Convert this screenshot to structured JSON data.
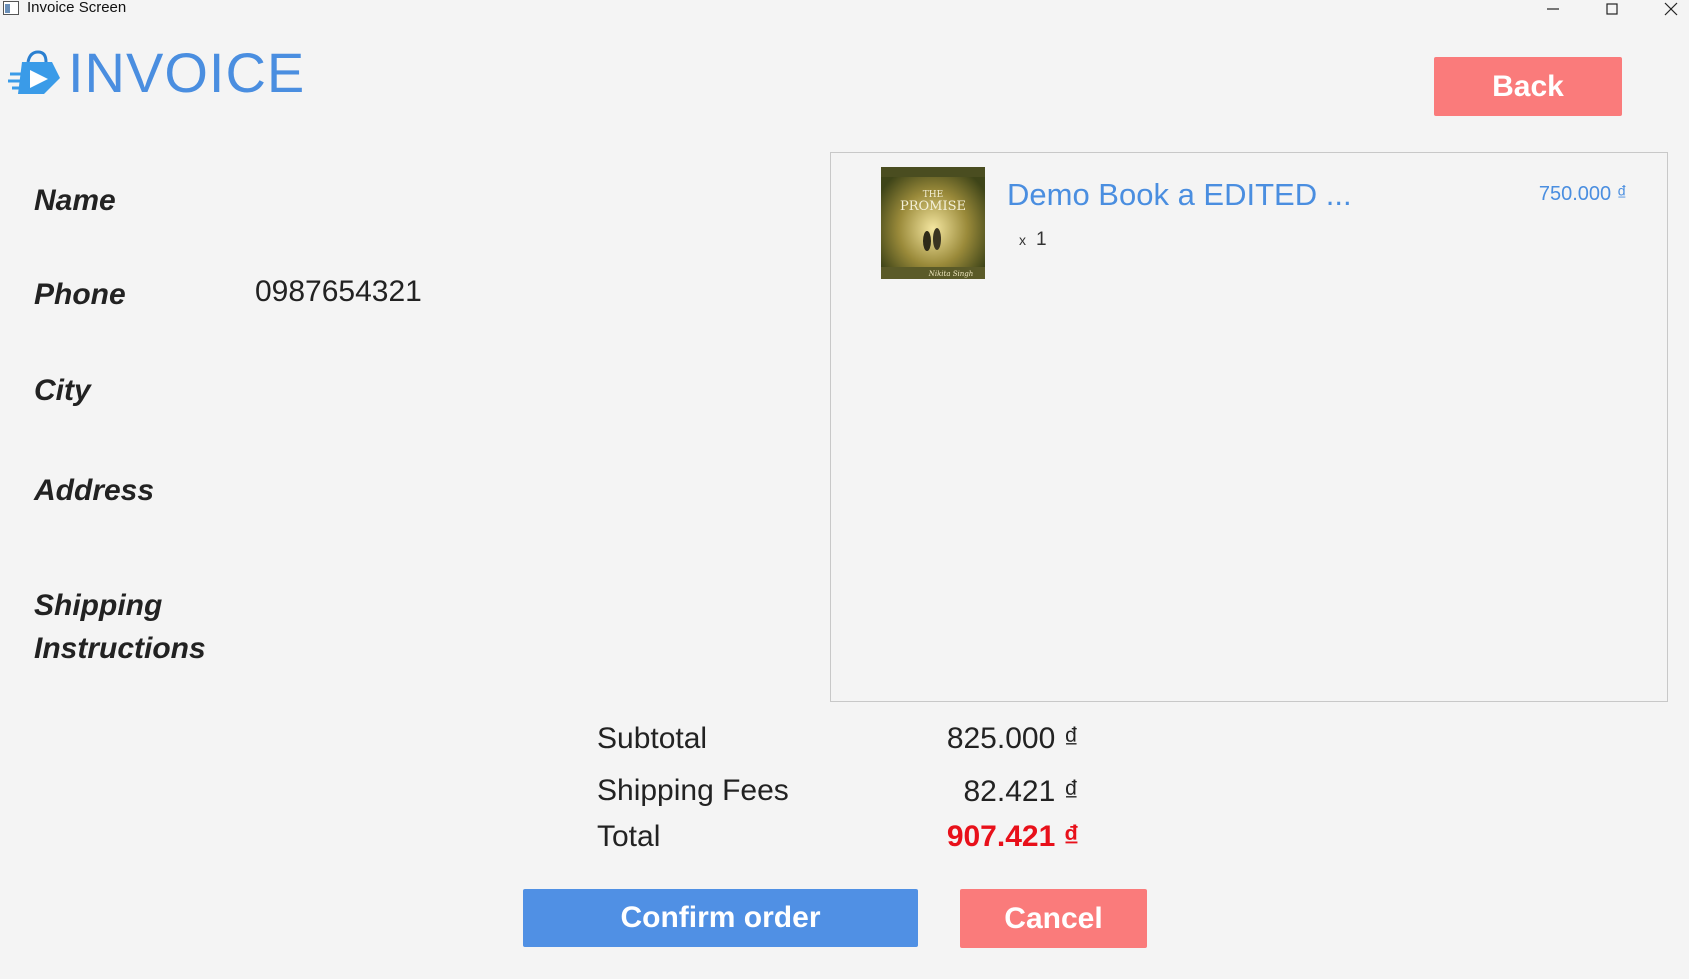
{
  "window": {
    "title": "Invoice Screen"
  },
  "header": {
    "title": "INVOICE",
    "back_label": "Back"
  },
  "form": {
    "name_label": "Name",
    "name_value": "",
    "phone_label": "Phone",
    "phone_value": "0987654321",
    "city_label": "City",
    "city_value": "",
    "address_label": "Address",
    "address_value": "",
    "shipping_label_line1": "Shipping",
    "shipping_label_line2": "Instructions",
    "shipping_value": ""
  },
  "cart": {
    "items": [
      {
        "name": "Demo Book a EDITED ...",
        "qty_prefix": "x",
        "qty": "1",
        "price": "750.000 ₫",
        "cover_icon": "book-cover"
      }
    ]
  },
  "summary": {
    "subtotal_label": "Subtotal",
    "subtotal_value": "825.000 ₫",
    "shipping_label": "Shipping Fees",
    "shipping_value": "82.421 ₫",
    "total_label": "Total",
    "total_value": "907.421 ₫"
  },
  "actions": {
    "confirm_label": "Confirm order",
    "cancel_label": "Cancel"
  },
  "colors": {
    "accent": "#4a8ee0",
    "primary_button": "#5090e4",
    "danger_button": "#fa7b7b",
    "total": "#e8101a"
  }
}
